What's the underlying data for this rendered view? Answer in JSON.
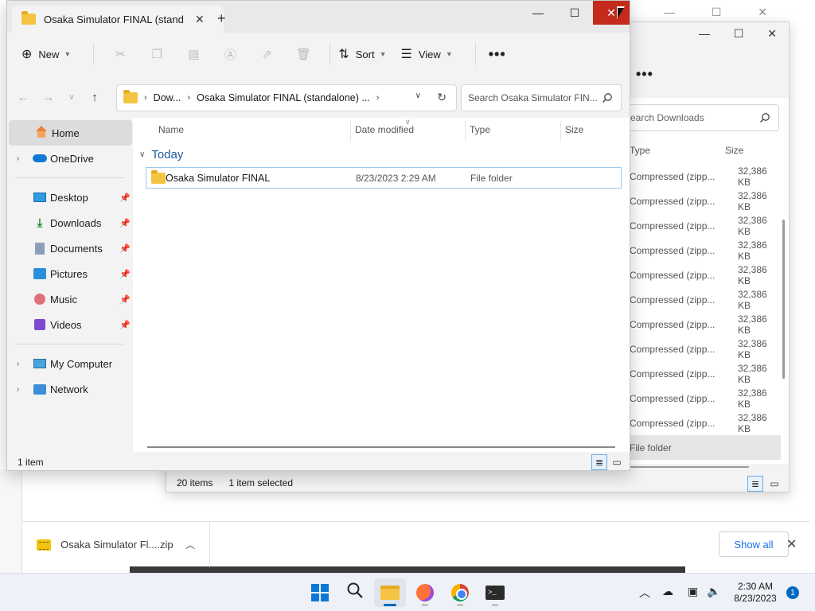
{
  "main_window": {
    "tab_title": "Osaka Simulator FINAL (stand",
    "new_tab_glyph": "+",
    "toolbar": {
      "new_label": "New",
      "sort_label": "Sort",
      "view_label": "View",
      "more_glyph": "•••"
    },
    "address": {
      "segments": [
        "Dow...",
        "Osaka Simulator FINAL (standalone) ..."
      ]
    },
    "search_placeholder": "Search Osaka Simulator FIN...",
    "sidebar": {
      "items": [
        {
          "label": "Home",
          "icon": "home-icon"
        },
        {
          "label": "OneDrive",
          "icon": "onedrive-icon"
        },
        {
          "label": "Desktop",
          "icon": "desktop-icon"
        },
        {
          "label": "Downloads",
          "icon": "downloads-icon"
        },
        {
          "label": "Documents",
          "icon": "documents-icon"
        },
        {
          "label": "Pictures",
          "icon": "pictures-icon"
        },
        {
          "label": "Music",
          "icon": "music-icon"
        },
        {
          "label": "Videos",
          "icon": "videos-icon"
        },
        {
          "label": "My Computer",
          "icon": "computer-icon"
        },
        {
          "label": "Network",
          "icon": "network-icon"
        }
      ]
    },
    "columns": {
      "name": "Name",
      "date": "Date modified",
      "type": "Type",
      "size": "Size"
    },
    "group_label": "Today",
    "files": [
      {
        "name": "Osaka Simulator FINAL",
        "date": "8/23/2023 2:29 AM",
        "type": "File folder",
        "size": ""
      }
    ],
    "status": "1 item"
  },
  "downloads_window": {
    "search_placeholder": "earch Downloads",
    "columns": {
      "type": "Type",
      "size": "Size"
    },
    "rows": [
      {
        "type": "Compressed (zipp...",
        "size": "32,386 KB"
      },
      {
        "type": "Compressed (zipp...",
        "size": "32,386 KB"
      },
      {
        "type": "Compressed (zipp...",
        "size": "32,386 KB"
      },
      {
        "type": "Compressed (zipp...",
        "size": "32,386 KB"
      },
      {
        "type": "Compressed (zipp...",
        "size": "32,386 KB"
      },
      {
        "type": "Compressed (zipp...",
        "size": "32,386 KB"
      },
      {
        "type": "Compressed (zipp...",
        "size": "32,386 KB"
      },
      {
        "type": "Compressed (zipp...",
        "size": "32,386 KB"
      },
      {
        "type": "Compressed (zipp...",
        "size": "32,386 KB"
      },
      {
        "type": "Compressed (zipp...",
        "size": "32,386 KB"
      },
      {
        "type": "Compressed (zipp...",
        "size": "32,386 KB"
      },
      {
        "type": "File folder",
        "size": ""
      }
    ],
    "status_count": "20 items",
    "status_selected": "1 item selected"
  },
  "download_shelf": {
    "file_name": "Osaka Simulator Fl....zip",
    "show_all_label": "Show all"
  },
  "taskbar": {
    "time": "2:30 AM",
    "date": "8/23/2023",
    "notification_count": "1"
  },
  "colors": {
    "close_red": "#c42b1c",
    "accent_blue": "#0067c0",
    "folder_yellow": "#f5c342"
  }
}
